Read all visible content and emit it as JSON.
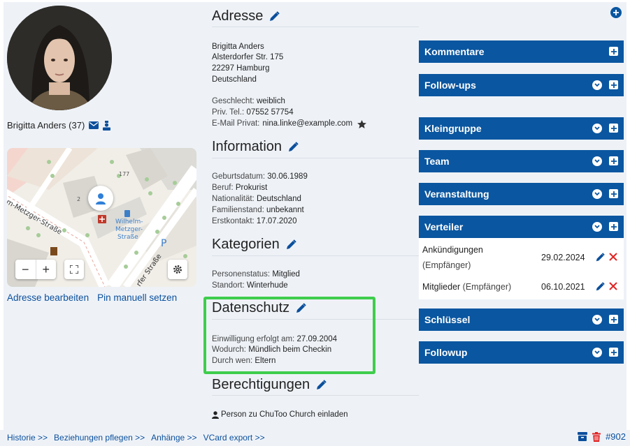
{
  "person": {
    "name": "Brigitta Anders (37)"
  },
  "map": {
    "labels": [
      "177",
      "2",
      "m-Metzger-Straße",
      "Wilhelm-",
      "Metzger-",
      "Straße",
      "P",
      "rfer Straße"
    ]
  },
  "left_links": {
    "edit_address": "Adresse bearbeiten",
    "set_pin": "Pin manuell setzen"
  },
  "sections": {
    "adresse": {
      "title": "Adresse",
      "lines": [
        "Brigitta Anders",
        "Alsterdorfer Str. 175",
        "22297 Hamburg",
        "Deutschland"
      ],
      "fields": [
        {
          "key": "Geschlecht:",
          "value": "weiblich"
        },
        {
          "key": "Priv. Tel.:",
          "value": "07552 57754"
        },
        {
          "key": "E-Mail Privat:",
          "value": "nina.linke@example.com"
        }
      ]
    },
    "information": {
      "title": "Information",
      "fields": [
        {
          "key": "Geburtsdatum:",
          "value": "30.06.1989"
        },
        {
          "key": "Beruf:",
          "value": "Prokurist"
        },
        {
          "key": "Nationalität:",
          "value": "Deutschland"
        },
        {
          "key": "Familienstand:",
          "value": "unbekannt"
        },
        {
          "key": "Erstkontakt:",
          "value": "17.07.2020"
        }
      ]
    },
    "kategorien": {
      "title": "Kategorien",
      "fields": [
        {
          "key": "Personenstatus:",
          "value": "Mitglied"
        },
        {
          "key": "Standort:",
          "value": "Winterhude"
        }
      ]
    },
    "datenschutz": {
      "title": "Datenschutz",
      "fields": [
        {
          "key": "Einwilligung erfolgt am:",
          "value": "27.09.2004"
        },
        {
          "key": "Wodurch:",
          "value": "Mündlich beim Checkin"
        },
        {
          "key": "Durch wen:",
          "value": "Eltern"
        }
      ]
    },
    "berechtigungen": {
      "title": "Berechtigungen",
      "invite": "Person zu ChuToo Church einladen"
    }
  },
  "panels": {
    "kommentare": "Kommentare",
    "followups": "Follow-ups",
    "kleingruppe": "Kleingruppe",
    "team": "Team",
    "veranstaltung": "Veranstaltung",
    "verteiler": "Verteiler",
    "schluessel": "Schlüssel",
    "followup": "Followup"
  },
  "verteiler_rows": [
    {
      "name": "Ankündigungen",
      "role": "(Empfänger)",
      "date": "29.02.2024"
    },
    {
      "name": "Mitglieder",
      "role": "(Empfänger)",
      "date": "06.10.2021"
    }
  ],
  "footer": {
    "links": [
      "Historie >>",
      "Beziehungen pflegen >>",
      "Anhänge >>",
      "VCard export >>"
    ],
    "id": "#902"
  },
  "colors": {
    "primary": "#0a56a0",
    "highlight": "#3fcd4c",
    "delete": "#e02424",
    "background": "#eef2f7"
  }
}
